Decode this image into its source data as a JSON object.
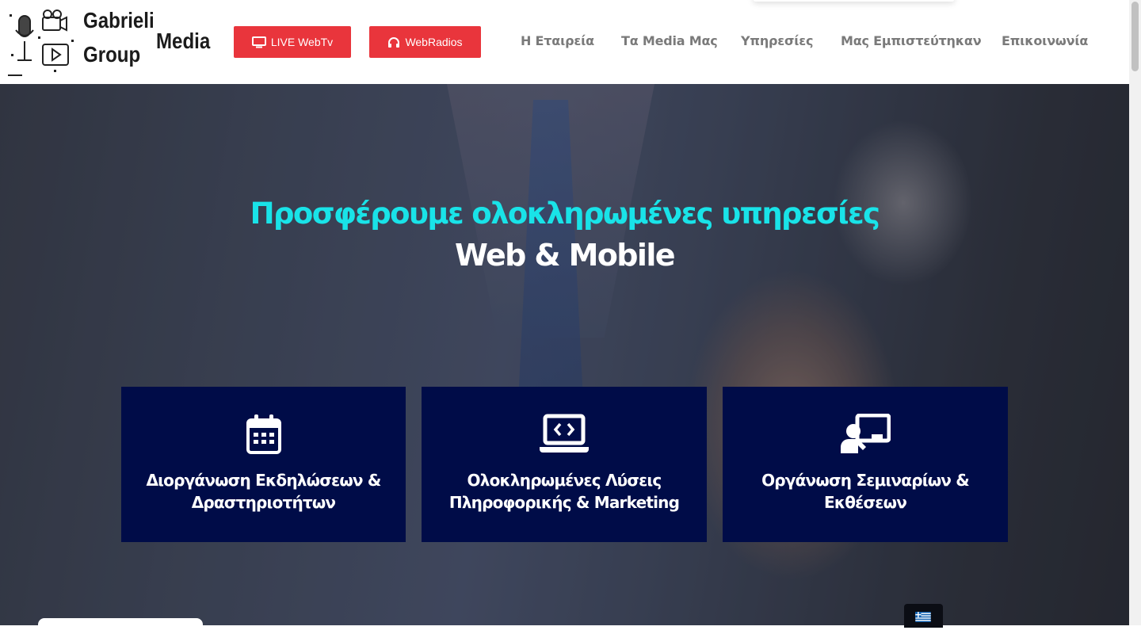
{
  "logo": {
    "word1": "Gabrieli",
    "word2": "Media",
    "word3": "Group"
  },
  "header": {
    "webtv_button": "LIVE WebTv",
    "webradios_button": "WebRadios",
    "nav": [
      {
        "label": "Η Εταιρεία"
      },
      {
        "label": "Τα Media Μας"
      },
      {
        "label": "Υπηρεσίες"
      },
      {
        "label": "Μας Εμπιστεύτηκαν"
      },
      {
        "label": "Επικοινωνία"
      }
    ]
  },
  "hero": {
    "title": "Προσφέρουμε ολοκληρωμένες υπηρεσίες",
    "subtitle": "Web & Mobile",
    "cards": [
      {
        "icon": "calendar-icon",
        "line1": "Διοργάνωση Εκδηλώσεων &",
        "line2": "Δραστηριοτήτων"
      },
      {
        "icon": "laptop-code-icon",
        "line1": "Ολοκληρωμένες Λύσεις",
        "line2": "Πληροφορικής & Marketing"
      },
      {
        "icon": "chalkboard-teacher-icon",
        "line1": "Οργάνωση Σεμιναρίων &",
        "line2": "Εκθέσεων"
      }
    ]
  },
  "language": {
    "icon": "greek-flag-icon"
  },
  "colors": {
    "accent_red": "#e9353c",
    "hero_title": "#19e3e8",
    "card_bg": "#000c48",
    "nav_text": "#7a7a7a"
  }
}
